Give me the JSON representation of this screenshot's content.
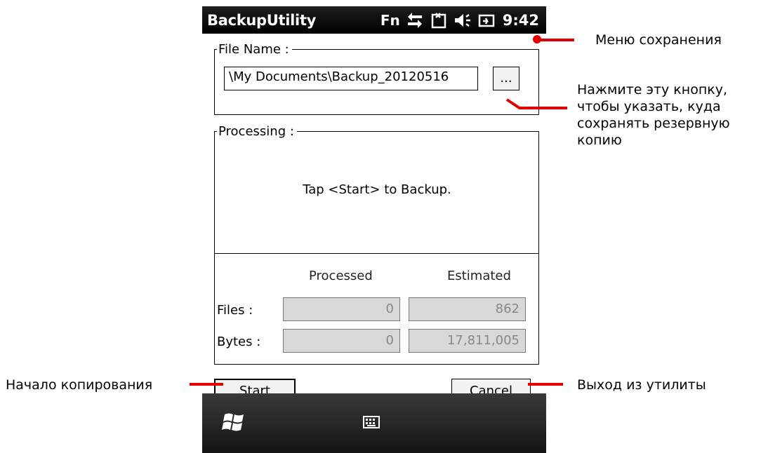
{
  "statusbar": {
    "app_title": "BackupUtility",
    "fn_label": "Fn",
    "time": "9:42",
    "icons": [
      "connection-arrows-icon",
      "sync-icon",
      "volume-icon",
      "battery-charging-icon"
    ]
  },
  "file_name": {
    "legend": "File Name :",
    "path_value": "\\My Documents\\Backup_20120516",
    "browse_label": "..."
  },
  "processing": {
    "legend": "Processing :",
    "message": "Tap <Start> to Backup."
  },
  "stats": {
    "col_processed": "Processed",
    "col_estimated": "Estimated",
    "rows": [
      {
        "label": "Files :",
        "processed": "0",
        "estimated": "862"
      },
      {
        "label": "Bytes :",
        "processed": "0",
        "estimated": "17,811,005"
      }
    ]
  },
  "buttons": {
    "start": "Start",
    "cancel": "Cancel"
  },
  "callouts": {
    "save_menu": "Меню сохранения",
    "browse_line1": "Нажмите эту кнопку,",
    "browse_line2": "чтобы указать, куда",
    "browse_line3": "сохранять резервную",
    "browse_line4": "копию",
    "start_copy": "Начало копирования",
    "exit_utility": "Выход из утилиты"
  },
  "colors": {
    "callout_red": "#e30000",
    "statusbar_bg": "#000000",
    "disabled_field": "#d8d8d8"
  }
}
